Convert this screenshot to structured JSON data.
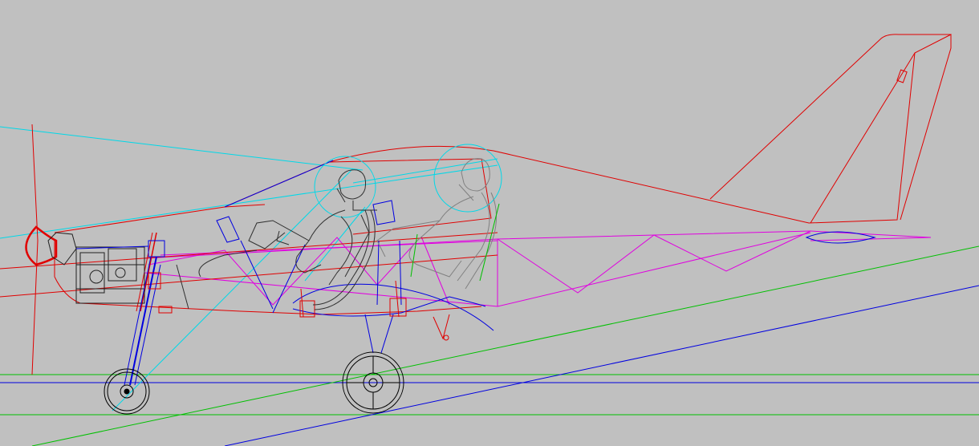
{
  "view": "side-elevation-cad-drawing",
  "colors": {
    "background": "#c0c0c0",
    "fuselage": "#e00000",
    "structure": "#0000e0",
    "truss": "#e000e0",
    "sightline": "#00d8e8",
    "ground": "#00c000",
    "pilot": "#404040",
    "wheel": "#000000"
  },
  "components": [
    "propeller",
    "spinner-icon",
    "engine",
    "firewall",
    "canopy",
    "fuselage",
    "vertical-tail",
    "horizontal-tail",
    "tailboom-truss",
    "front-pilot",
    "rear-pilot",
    "front-seat",
    "nose-gear",
    "nose-wheel",
    "main-gear",
    "main-wheel",
    "ground-lines",
    "reference-lines"
  ]
}
